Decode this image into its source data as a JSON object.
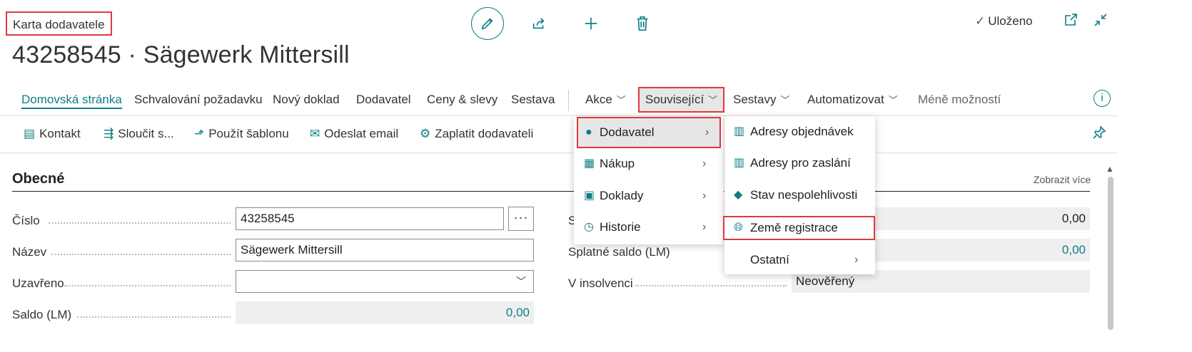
{
  "header": {
    "caption": "Karta dodavatele",
    "title": "43258545 · Sägewerk Mittersill",
    "saved_label": "Uloženo"
  },
  "action_bar": {
    "items": [
      "Domovská stránka",
      "Schvalování požadavku",
      "Nový doklad",
      "Dodavatel",
      "Ceny & slevy",
      "Sestava"
    ],
    "menus": [
      "Akce",
      "Související",
      "Sestavy",
      "Automatizovat"
    ],
    "less_options": "Méně možností"
  },
  "promoted": [
    "Kontakt",
    "Sloučit s...",
    "Použít šablonu",
    "Odeslat email",
    "Zaplatit dodavateli"
  ],
  "section": {
    "title": "Obecné",
    "show_more": "Zobrazit více"
  },
  "fields": {
    "number_label": "Číslo",
    "number_value": "43258545",
    "name_label": "Název",
    "name_value": "Sägewerk Mittersill",
    "blocked_label": "Uzavřeno",
    "blocked_value": "",
    "balance_label": "Saldo (LM)",
    "balance_value": "0,00",
    "right1_label": "S",
    "right1_value": "0,00",
    "overdue_label": "Splatné saldo (LM)",
    "overdue_value": "0,00",
    "insolvency_label": "V insolvenci",
    "insolvency_value": "Neověřený"
  },
  "related_menu": {
    "items": [
      "Dodavatel",
      "Nákup",
      "Doklady",
      "Historie"
    ]
  },
  "vendor_submenu": {
    "items": [
      "Adresy objednávek",
      "Adresy pro zaslání",
      "Stav nespolehlivosti",
      "Země registrace",
      "Ostatní"
    ]
  },
  "colors": {
    "accent": "#0f7d86",
    "highlight": "#e0393e"
  }
}
